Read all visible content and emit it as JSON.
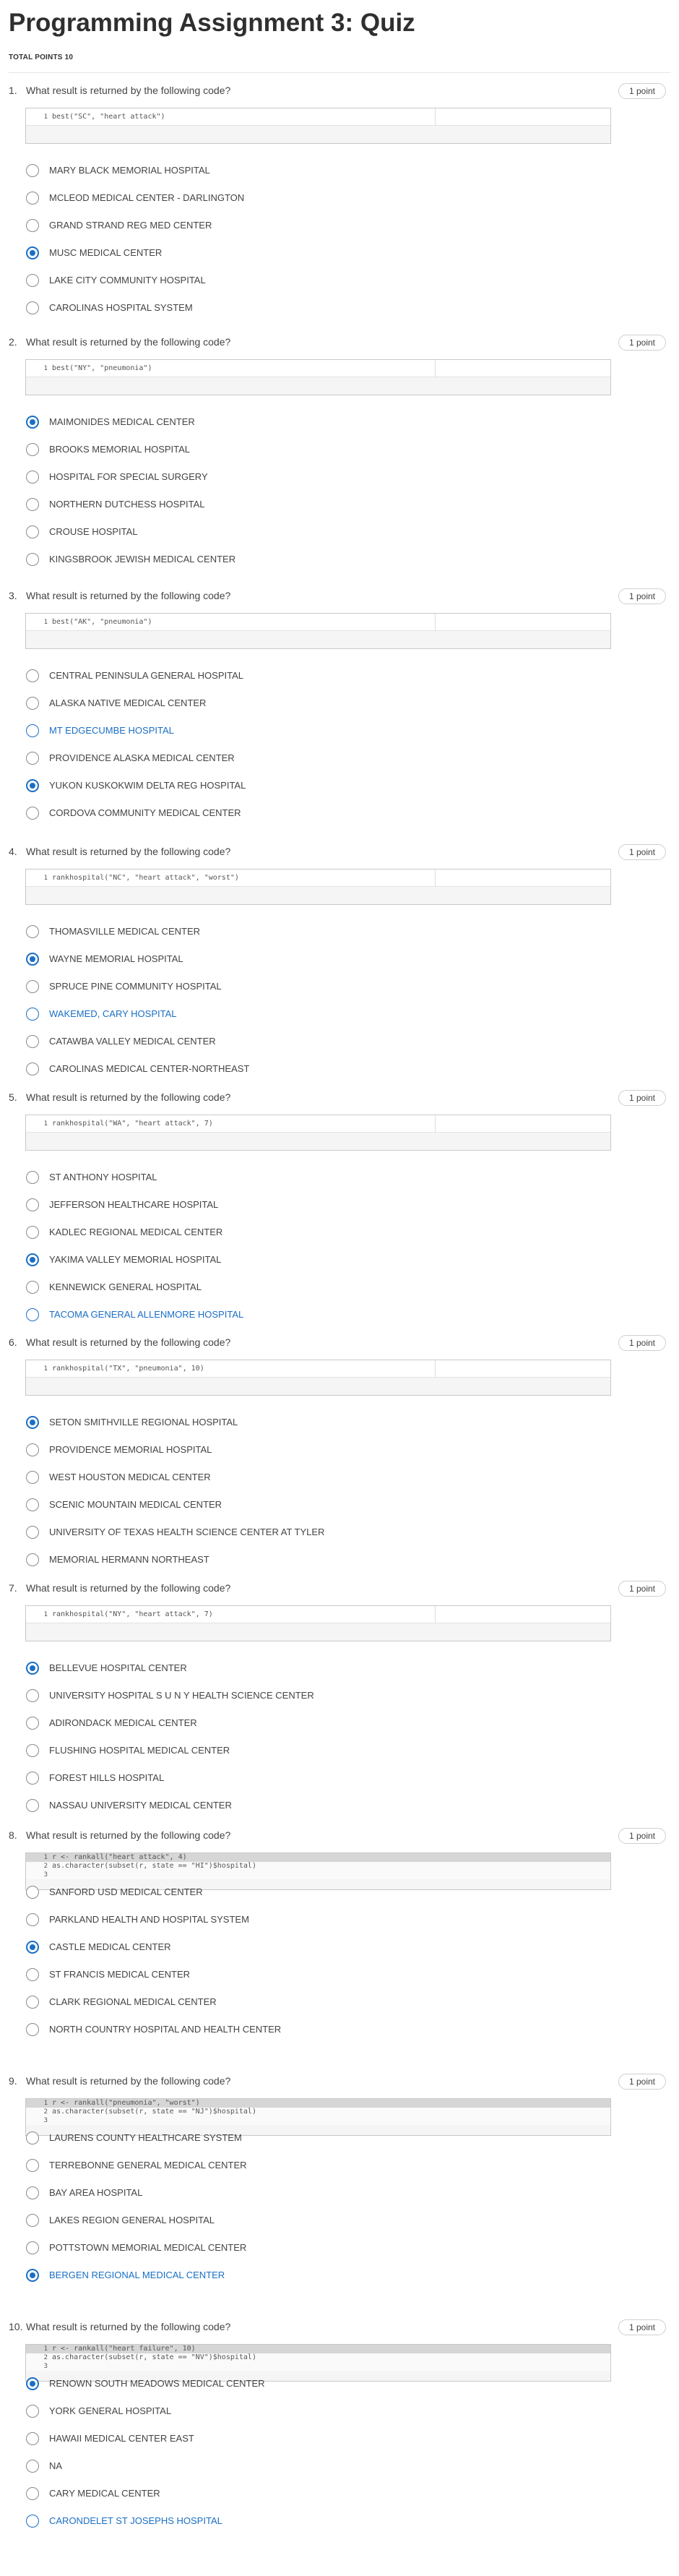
{
  "page": {
    "title": "Programming Assignment 3: Quiz",
    "total_points_label": "TOTAL POINTS 10"
  },
  "questions": [
    {
      "number": "1.",
      "prompt": "What result is returned by the following code?",
      "points": "1 point",
      "code": [
        {
          "ln": "1",
          "text": "best(\"SC\", \"heart attack\")"
        }
      ],
      "options": [
        {
          "label": "MARY BLACK MEMORIAL HOSPITAL",
          "state": "unchecked"
        },
        {
          "label": "MCLEOD MEDICAL CENTER - DARLINGTON",
          "state": "unchecked"
        },
        {
          "label": "GRAND STRAND REG MED CENTER",
          "state": "unchecked"
        },
        {
          "label": "MUSC MEDICAL CENTER",
          "state": "checked"
        },
        {
          "label": "LAKE CITY COMMUNITY HOSPITAL",
          "state": "unchecked"
        },
        {
          "label": "CAROLINAS HOSPITAL SYSTEM",
          "state": "unchecked"
        }
      ]
    },
    {
      "number": "2.",
      "prompt": "What result is returned by the following code?",
      "points": "1 point",
      "code": [
        {
          "ln": "1",
          "text": "best(\"NY\", \"pneumonia\")"
        }
      ],
      "options": [
        {
          "label": "MAIMONIDES MEDICAL CENTER",
          "state": "checked"
        },
        {
          "label": "BROOKS MEMORIAL HOSPITAL",
          "state": "unchecked"
        },
        {
          "label": "HOSPITAL FOR SPECIAL SURGERY",
          "state": "unchecked"
        },
        {
          "label": "NORTHERN DUTCHESS HOSPITAL",
          "state": "unchecked"
        },
        {
          "label": "CROUSE HOSPITAL",
          "state": "unchecked"
        },
        {
          "label": "KINGSBROOK JEWISH MEDICAL CENTER",
          "state": "unchecked"
        }
      ]
    },
    {
      "number": "3.",
      "prompt": "What result is returned by the following code?",
      "points": "1 point",
      "code": [
        {
          "ln": "1",
          "text": "best(\"AK\", \"pneumonia\")"
        }
      ],
      "options": [
        {
          "label": "CENTRAL PENINSULA GENERAL HOSPITAL",
          "state": "unchecked"
        },
        {
          "label": "ALASKA NATIVE MEDICAL CENTER",
          "state": "unchecked"
        },
        {
          "label": "MT EDGECUMBE HOSPITAL",
          "state": "hover"
        },
        {
          "label": "PROVIDENCE ALASKA MEDICAL CENTER",
          "state": "unchecked"
        },
        {
          "label": "YUKON KUSKOKWIM DELTA REG HOSPITAL",
          "state": "checked"
        },
        {
          "label": "CORDOVA COMMUNITY MEDICAL CENTER",
          "state": "unchecked"
        }
      ]
    },
    {
      "number": "4.",
      "prompt": "What result is returned by the following code?",
      "points": "1 point",
      "code": [
        {
          "ln": "1",
          "text": "rankhospital(\"NC\", \"heart attack\", \"worst\")"
        }
      ],
      "options": [
        {
          "label": "THOMASVILLE MEDICAL CENTER",
          "state": "unchecked"
        },
        {
          "label": "WAYNE MEMORIAL HOSPITAL",
          "state": "checked"
        },
        {
          "label": "SPRUCE PINE COMMUNITY HOSPITAL",
          "state": "unchecked"
        },
        {
          "label": "WAKEMED, CARY HOSPITAL",
          "state": "hover"
        },
        {
          "label": "CATAWBA VALLEY MEDICAL CENTER",
          "state": "unchecked"
        },
        {
          "label": "CAROLINAS MEDICAL CENTER-NORTHEAST",
          "state": "unchecked"
        }
      ]
    },
    {
      "number": "5.",
      "prompt": "What result is returned by the following code?",
      "points": "1 point",
      "code": [
        {
          "ln": "1",
          "text": "rankhospital(\"WA\", \"heart attack\", 7)"
        }
      ],
      "options": [
        {
          "label": "ST ANTHONY HOSPITAL",
          "state": "unchecked"
        },
        {
          "label": "JEFFERSON HEALTHCARE HOSPITAL",
          "state": "unchecked"
        },
        {
          "label": "KADLEC REGIONAL MEDICAL CENTER",
          "state": "unchecked"
        },
        {
          "label": "YAKIMA VALLEY MEMORIAL HOSPITAL",
          "state": "checked"
        },
        {
          "label": "KENNEWICK GENERAL HOSPITAL",
          "state": "unchecked"
        },
        {
          "label": "TACOMA GENERAL ALLENMORE HOSPITAL",
          "state": "hover"
        }
      ]
    },
    {
      "number": "6.",
      "prompt": "What result is returned by the following code?",
      "points": "1 point",
      "code": [
        {
          "ln": "1",
          "text": "rankhospital(\"TX\", \"pneumonia\", 10)"
        }
      ],
      "options": [
        {
          "label": "SETON SMITHVILLE REGIONAL HOSPITAL",
          "state": "checked"
        },
        {
          "label": "PROVIDENCE MEMORIAL HOSPITAL",
          "state": "unchecked"
        },
        {
          "label": "WEST HOUSTON MEDICAL CENTER",
          "state": "unchecked"
        },
        {
          "label": "SCENIC MOUNTAIN MEDICAL CENTER",
          "state": "unchecked"
        },
        {
          "label": "UNIVERSITY OF TEXAS HEALTH SCIENCE CENTER AT TYLER",
          "state": "unchecked"
        },
        {
          "label": "MEMORIAL HERMANN NORTHEAST",
          "state": "unchecked"
        }
      ]
    },
    {
      "number": "7.",
      "prompt": "What result is returned by the following code?",
      "points": "1 point",
      "code": [
        {
          "ln": "1",
          "text": "rankhospital(\"NY\", \"heart attack\", 7)"
        }
      ],
      "options": [
        {
          "label": "BELLEVUE HOSPITAL CENTER",
          "state": "checked"
        },
        {
          "label": "UNIVERSITY HOSPITAL S U N Y HEALTH SCIENCE CENTER",
          "state": "unchecked"
        },
        {
          "label": "ADIRONDACK MEDICAL CENTER",
          "state": "unchecked"
        },
        {
          "label": "FLUSHING HOSPITAL MEDICAL CENTER",
          "state": "unchecked"
        },
        {
          "label": "FOREST HILLS HOSPITAL",
          "state": "unchecked"
        },
        {
          "label": "NASSAU UNIVERSITY MEDICAL CENTER",
          "state": "unchecked"
        }
      ]
    },
    {
      "number": "8.",
      "prompt": "What result is returned by the following code?",
      "points": "1 point",
      "code": [
        {
          "ln": "1",
          "text": "r <- rankall(\"heart attack\", 4)"
        },
        {
          "ln": "2",
          "text": "as.character(subset(r, state == \"HI\")$hospital)"
        },
        {
          "ln": "3",
          "text": ""
        }
      ],
      "options": [
        {
          "label": "SANFORD USD MEDICAL CENTER",
          "state": "unchecked"
        },
        {
          "label": "PARKLAND HEALTH AND HOSPITAL SYSTEM",
          "state": "unchecked"
        },
        {
          "label": "CASTLE MEDICAL CENTER",
          "state": "checked"
        },
        {
          "label": "ST FRANCIS MEDICAL CENTER",
          "state": "unchecked"
        },
        {
          "label": "CLARK REGIONAL MEDICAL CENTER",
          "state": "unchecked"
        },
        {
          "label": "NORTH COUNTRY HOSPITAL AND HEALTH CENTER",
          "state": "unchecked"
        }
      ]
    },
    {
      "number": "9.",
      "prompt": "What result is returned by the following code?",
      "points": "1 point",
      "code": [
        {
          "ln": "1",
          "text": "r <- rankall(\"pneumonia\", \"worst\")"
        },
        {
          "ln": "2",
          "text": "as.character(subset(r, state == \"NJ\")$hospital)"
        },
        {
          "ln": "3",
          "text": ""
        }
      ],
      "options": [
        {
          "label": "LAURENS COUNTY HEALTHCARE SYSTEM",
          "state": "unchecked"
        },
        {
          "label": "TERREBONNE GENERAL MEDICAL CENTER",
          "state": "unchecked"
        },
        {
          "label": "BAY AREA HOSPITAL",
          "state": "unchecked"
        },
        {
          "label": "LAKES REGION GENERAL HOSPITAL",
          "state": "unchecked"
        },
        {
          "label": "POTTSTOWN MEMORIAL MEDICAL CENTER",
          "state": "unchecked"
        },
        {
          "label": "BERGEN REGIONAL MEDICAL CENTER",
          "state": "checked-blue"
        }
      ]
    },
    {
      "number": "10.",
      "prompt": "What result is returned by the following code?",
      "points": "1 point",
      "code": [
        {
          "ln": "1",
          "text": "r <- rankall(\"heart failure\", 10)"
        },
        {
          "ln": "2",
          "text": "as.character(subset(r, state == \"NV\")$hospital)"
        },
        {
          "ln": "3",
          "text": ""
        }
      ],
      "options": [
        {
          "label": "RENOWN SOUTH MEADOWS MEDICAL CENTER",
          "state": "checked"
        },
        {
          "label": "YORK GENERAL HOSPITAL",
          "state": "unchecked"
        },
        {
          "label": "HAWAII MEDICAL CENTER EAST",
          "state": "unchecked"
        },
        {
          "label": "NA",
          "state": "unchecked"
        },
        {
          "label": "CARY MEDICAL CENTER",
          "state": "unchecked"
        },
        {
          "label": "CARONDELET ST JOSEPHS HOSPITAL",
          "state": "hover"
        }
      ]
    }
  ]
}
